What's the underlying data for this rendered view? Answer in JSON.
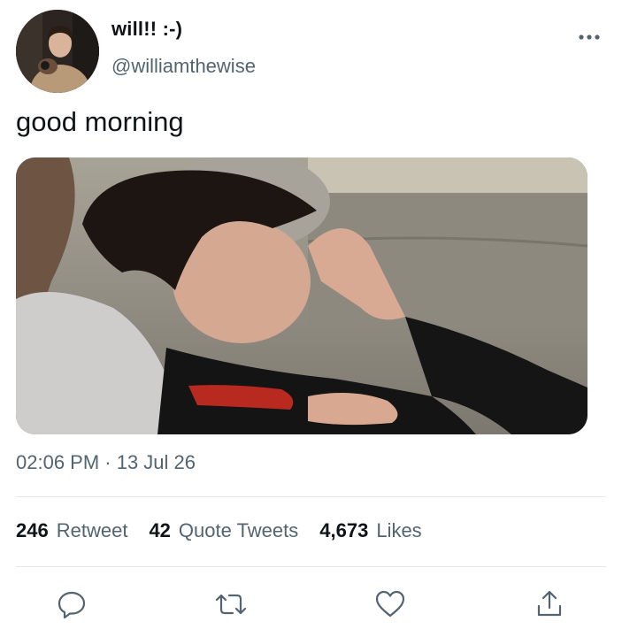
{
  "author": {
    "display_name": "will!! :-)",
    "handle": "@williamthewise"
  },
  "tweet": {
    "text": "good morning",
    "timestamp": "02:06 PM · 13 Jul 26"
  },
  "stats": [
    {
      "count": "246",
      "label": "Retweet"
    },
    {
      "count": "42",
      "label": "Quote Tweets"
    },
    {
      "count": "4,673",
      "label": "Likes"
    }
  ],
  "actions": {
    "icons": [
      "reply-icon",
      "retweet-icon",
      "like-icon",
      "share-icon"
    ]
  },
  "colors": {
    "text_primary": "#0f1419",
    "text_secondary": "#536471",
    "divider": "#e4e7ea"
  }
}
